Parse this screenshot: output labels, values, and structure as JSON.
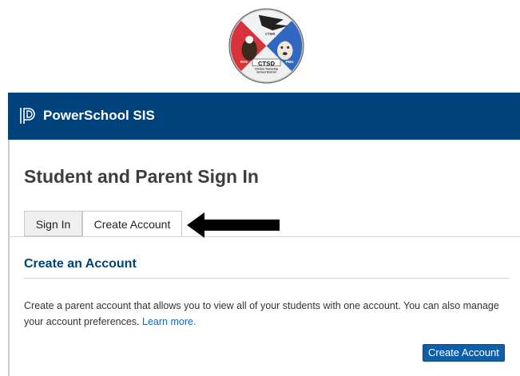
{
  "logo": {
    "center_text": "CTSD",
    "sub_text_1": "Clinton Township",
    "sub_text_2": "School District",
    "label_top": "CTMS",
    "label_left": "RVS",
    "label_right": "PMG"
  },
  "header": {
    "app_name": "PowerSchool SIS"
  },
  "page": {
    "title": "Student and Parent Sign In"
  },
  "tabs": [
    {
      "label": "Sign In",
      "active": false
    },
    {
      "label": "Create Account",
      "active": true
    }
  ],
  "section": {
    "title": "Create an Account",
    "description": "Create a parent account that allows you to view all of your students with one account. You can also manage your account preferences.",
    "link_text": "Learn more."
  },
  "actions": {
    "create_account_label": "Create Account"
  },
  "colors": {
    "header_bg": "#00427c",
    "accent": "#0f5fa8",
    "link": "#1566b7"
  }
}
